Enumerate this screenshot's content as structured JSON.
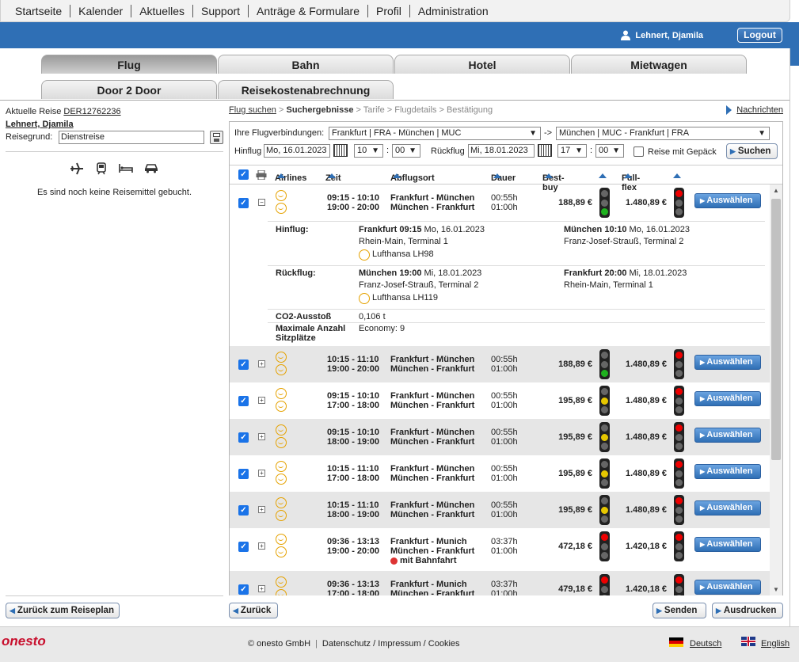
{
  "topnav": [
    "Startseite",
    "Kalender",
    "Aktuelles",
    "Support",
    "Anträge & Formulare",
    "Profil",
    "Administration"
  ],
  "user": {
    "name": "Lehnert, Djamila",
    "logout": "Logout"
  },
  "tabs": {
    "flug": "Flug",
    "bahn": "Bahn",
    "hotel": "Hotel",
    "mietwagen": "Mietwagen",
    "door": "Door 2 Door",
    "reisekosten": "Reisekostenabrechnung"
  },
  "left": {
    "trip_label": "Aktuelle Reise",
    "trip_id": "DER12762236",
    "traveler": "Lehnert, Djamila",
    "reason_label": "Reisegrund:",
    "reason_value": "Dienstreise",
    "empty": "Es sind noch keine Reisemittel gebucht.",
    "back_plan": "Zurück zum Reiseplan"
  },
  "breadcrumb": {
    "s1": "Flug suchen",
    "s2": "Suchergebnisse",
    "rest": " > Tarife > Flugdetails > Bestätigung"
  },
  "messages": "Nachrichten",
  "search": {
    "label": "Ihre Flugverbindungen:",
    "outbound": "Frankfurt | FRA - München | MUC",
    "arrow": "->",
    "inbound": "München | MUC - Frankfurt | FRA",
    "hin_label": "Hinflug",
    "hin_date": "Mo, 16.01.2023",
    "hin_h": "10",
    "hin_m": "00",
    "rueck_label": "Rückflug",
    "rueck_date": "Mi, 18.01.2023",
    "rueck_h": "17",
    "rueck_m": "00",
    "luggage": "Reise mit Gepäck",
    "search_btn": "Suchen",
    "colon": ":"
  },
  "headers": {
    "airlines": "Airlines",
    "zeit": "Zeit",
    "ort": "Abflugsort",
    "dauer": "Dauer",
    "best": "Best-buy",
    "flex": "Full-flex"
  },
  "flights": [
    {
      "t1": "09:15 - 10:10",
      "t2": "19:00 - 20:00",
      "o1": "Frankfurt - München",
      "o2": "München - Frankfurt",
      "d1": "00:55h",
      "d2": "01:00h",
      "best": "188,89 €",
      "flex": "1.480,89 €",
      "light": "green",
      "sign": "−"
    },
    {
      "t1": "10:15 - 11:10",
      "t2": "19:00 - 20:00",
      "o1": "Frankfurt - München",
      "o2": "München - Frankfurt",
      "d1": "00:55h",
      "d2": "01:00h",
      "best": "188,89 €",
      "flex": "1.480,89 €",
      "light": "green",
      "sign": "+"
    },
    {
      "t1": "09:15 - 10:10",
      "t2": "17:00 - 18:00",
      "o1": "Frankfurt - München",
      "o2": "München - Frankfurt",
      "d1": "00:55h",
      "d2": "01:00h",
      "best": "195,89 €",
      "flex": "1.480,89 €",
      "light": "yellow",
      "sign": "+"
    },
    {
      "t1": "09:15 - 10:10",
      "t2": "18:00 - 19:00",
      "o1": "Frankfurt - München",
      "o2": "München - Frankfurt",
      "d1": "00:55h",
      "d2": "01:00h",
      "best": "195,89 €",
      "flex": "1.480,89 €",
      "light": "yellow",
      "sign": "+"
    },
    {
      "t1": "10:15 - 11:10",
      "t2": "17:00 - 18:00",
      "o1": "Frankfurt - München",
      "o2": "München - Frankfurt",
      "d1": "00:55h",
      "d2": "01:00h",
      "best": "195,89 €",
      "flex": "1.480,89 €",
      "light": "yellow",
      "sign": "+"
    },
    {
      "t1": "10:15 - 11:10",
      "t2": "18:00 - 19:00",
      "o1": "Frankfurt - München",
      "o2": "München - Frankfurt",
      "d1": "00:55h",
      "d2": "01:00h",
      "best": "195,89 €",
      "flex": "1.480,89 €",
      "light": "yellow",
      "sign": "+"
    },
    {
      "t1": "09:36 - 13:13",
      "t2": "19:00 - 20:00",
      "o1": "Frankfurt - Munich",
      "o2": "München - Frankfurt",
      "d1": "03:37h",
      "d2": "01:00h",
      "best": "472,18 €",
      "flex": "1.420,18 €",
      "light": "red",
      "sign": "+",
      "note": "mit Bahnfahrt"
    },
    {
      "t1": "09:36 - 13:13",
      "t2": "17:00 - 18:00",
      "o1": "Frankfurt - Munich",
      "o2": "München - Frankfurt",
      "d1": "03:37h",
      "d2": "01:00h",
      "best": "479,18 €",
      "flex": "1.420,18 €",
      "light": "red",
      "sign": "+"
    }
  ],
  "choose": "Auswählen",
  "detail": {
    "hin_label": "Hinflug:",
    "hin_from": "Frankfurt 09:15",
    "hin_from_date": " Mo, 16.01.2023",
    "hin_from_term": "Rhein-Main, Terminal  1",
    "hin_airline": "Lufthansa LH98",
    "hin_to": "München 10:10",
    "hin_to_date": " Mo, 16.01.2023",
    "hin_to_term": "Franz-Josef-Strauß, Terminal  2",
    "rueck_label": "Rückflug:",
    "rueck_from": "München 19:00",
    "rueck_from_date": " Mi, 18.01.2023",
    "rueck_from_term": "Franz-Josef-Strauß, Terminal  2",
    "rueck_airline": "Lufthansa LH119",
    "rueck_to": "Frankfurt 20:00",
    "rueck_to_date": " Mi, 18.01.2023",
    "rueck_to_term": "Rhein-Main, Terminal  1",
    "co2_label": "CO2-Ausstoß",
    "co2": "0,106 t",
    "seats_label1": "Maximale Anzahl",
    "seats_label2": "Sitzplätze",
    "seats": "Economy: 9"
  },
  "bottom": {
    "back": "Zurück",
    "send": "Senden",
    "print": "Ausdrucken"
  },
  "footer": {
    "logo": "onesto",
    "copy": "© onesto GmbH",
    "links": "Datenschutz / Impressum / Cookies",
    "de": "Deutsch",
    "en": "English"
  }
}
